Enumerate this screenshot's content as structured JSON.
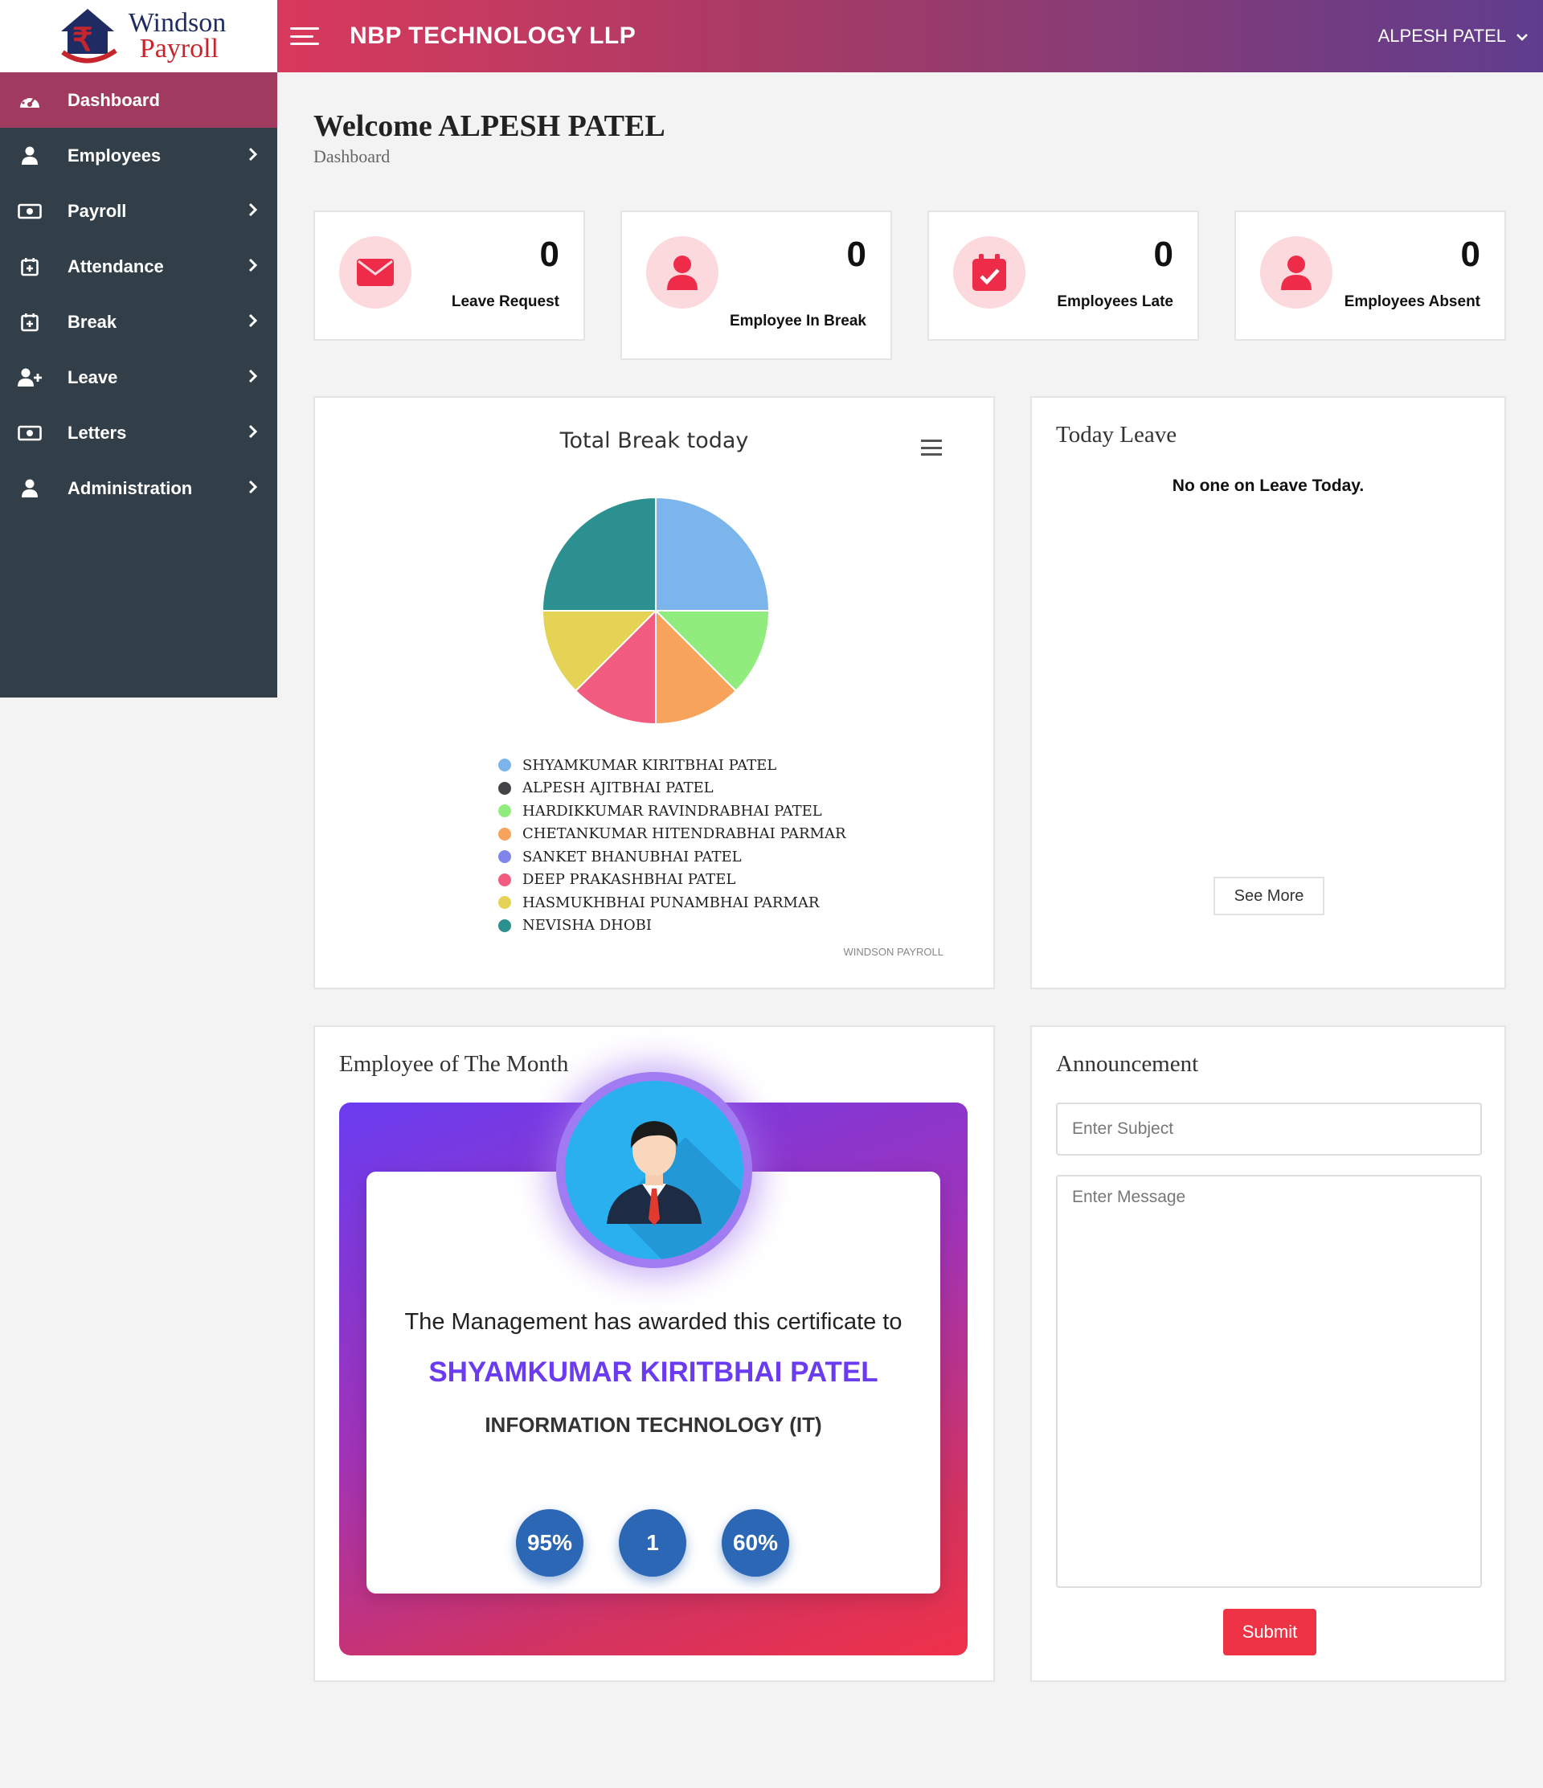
{
  "brand": {
    "line1": "Windson",
    "line2": "Payroll"
  },
  "topbar": {
    "company": "NBP TECHNOLOGY LLP",
    "user": "ALPESH PATEL"
  },
  "sidebar": {
    "items": [
      {
        "label": "Dashboard",
        "icon": "tachometer-icon",
        "active": true
      },
      {
        "label": "Employees",
        "icon": "user-icon"
      },
      {
        "label": "Payroll",
        "icon": "money-icon"
      },
      {
        "label": "Attendance",
        "icon": "calendar-plus-icon"
      },
      {
        "label": "Break",
        "icon": "calendar-plus-icon"
      },
      {
        "label": "Leave",
        "icon": "user-plus-icon"
      },
      {
        "label": "Letters",
        "icon": "money-icon"
      },
      {
        "label": "Administration",
        "icon": "user-icon"
      }
    ]
  },
  "page": {
    "welcome": "Welcome ALPESH PATEL",
    "breadcrumb": "Dashboard"
  },
  "stats": [
    {
      "value": "0",
      "label": "Leave Request",
      "icon": "envelope-icon"
    },
    {
      "value": "0",
      "label": "Employee In Break",
      "icon": "user-icon"
    },
    {
      "value": "0",
      "label": "Employees Late",
      "icon": "calendar-check-icon"
    },
    {
      "value": "0",
      "label": "Employees Absent",
      "icon": "user-icon"
    }
  ],
  "chart_data": {
    "type": "pie",
    "title": "Total Break today",
    "legend_position": "bottom",
    "credit": "WINDSON PAYROLL",
    "series": [
      {
        "name": "SHYAMKUMAR KIRITBHAI PATEL",
        "value": 25,
        "color": "#7cb5ec"
      },
      {
        "name": "ALPESH AJITBHAI PATEL",
        "value": 0,
        "color": "#434348"
      },
      {
        "name": "HARDIKKUMAR RAVINDRABHAI PATEL",
        "value": 12.5,
        "color": "#90ed7d"
      },
      {
        "name": "CHETANKUMAR HITENDRABHAI PARMAR",
        "value": 12.5,
        "color": "#f7a35c"
      },
      {
        "name": "SANKET BHANUBHAI PATEL",
        "value": 0,
        "color": "#8085e9"
      },
      {
        "name": "DEEP PRAKASHBHAI PATEL",
        "value": 12.5,
        "color": "#f15c80"
      },
      {
        "name": "HASMUKHBHAI PUNAMBHAI PARMAR",
        "value": 12.5,
        "color": "#e4d354"
      },
      {
        "name": "NEVISHA DHOBI",
        "value": 25,
        "color": "#2b908f"
      }
    ]
  },
  "today_leave": {
    "title": "Today Leave",
    "message": "No one on Leave Today.",
    "see_more": "See More"
  },
  "employee_of_month": {
    "title": "Employee of The Month",
    "award_text": "The Management has awarded this certificate to",
    "name": "SHYAMKUMAR KIRITBHAI PATEL",
    "department": "INFORMATION TECHNOLOGY (IT)",
    "badges": [
      "95%",
      "1",
      "60%"
    ]
  },
  "announcement": {
    "title": "Announcement",
    "subject_placeholder": "Enter Subject",
    "message_placeholder": "Enter Message",
    "submit": "Submit"
  }
}
